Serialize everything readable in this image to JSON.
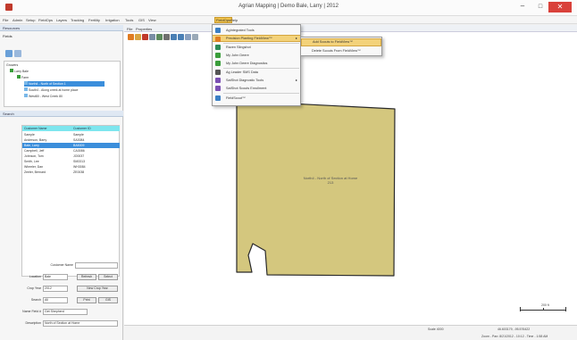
{
  "window": {
    "title": "Agrian Mapping | Demo Bale, Larry | 2012",
    "min_glyph": "–",
    "max_glyph": "□",
    "close_glyph": "✕"
  },
  "menubar": {
    "items": [
      "File",
      "Admin",
      "Setup",
      "FieldOps",
      "Layers",
      "Tracking",
      "Fertility",
      "Irrigation",
      "Tools",
      "GIS",
      "View",
      "FieldOps",
      "Help"
    ],
    "active_index": 11
  },
  "panels": {
    "resources_title": "Resources",
    "fields_label": "Fields",
    "growers_label": "Growers",
    "tree": {
      "root": "Growers",
      "grower": "Larry Bale",
      "farm": "Farm",
      "fields": [
        "North4 - North of Section 1",
        "South4 - Along creek at home place",
        "West80 - West Creek 80"
      ],
      "selected_index": 0
    },
    "search_title": "Search",
    "grid": {
      "headers": [
        "Customer Name",
        "Customer ID"
      ],
      "rows": [
        [
          "Sample",
          "Sample"
        ],
        [
          "Anderson, Barry",
          "SA3084"
        ],
        [
          "Bale, Larry",
          "BA5009"
        ],
        [
          "Campbell, Jeff",
          "CA3086"
        ],
        [
          "Johnson, Tom",
          "JO0037"
        ],
        [
          "Smith, Lee",
          "SM3313"
        ],
        [
          "Wheeler, Dan",
          "WH3084"
        ],
        [
          "Zeeler, Bernard",
          "ZE0038"
        ]
      ],
      "selected_index": 2
    },
    "form": {
      "customer_name_label": "Customer Name",
      "customer_name_value": "",
      "location_label": "Location",
      "location_value": "Bale",
      "refresh_btn": "Refresh",
      "select_btn": "Select",
      "crop_year_label": "Crop Year",
      "crop_year_value": "2012",
      "new_crop_year_btn": "New Crop Year",
      "search_label": "Search",
      "search_value": "All",
      "print_btn": "Print",
      "gis_btn": "GIS",
      "name_field_label": "Name Field #",
      "name_field_value": "Get Shepherd",
      "description_label": "Description",
      "description_value": "North of Section at Home"
    }
  },
  "map": {
    "tabs": [
      "File",
      "Properties"
    ],
    "field_label_line1": "North4 - North of Section at Home",
    "field_label_line2": "213",
    "field_fill": "#d4c77e",
    "field_stroke": "#2a2a2a",
    "scale_label": "200 ft"
  },
  "dropdown": {
    "items": [
      {
        "label": "AgIntegrated Tools",
        "icon_color": "#3b7fc4",
        "arrow": false
      },
      {
        "label": "Precision Planting FieldView™",
        "icon_color": "#e07b22",
        "arrow": true,
        "highlight": true
      },
      {
        "label": "Raven Slingshot",
        "icon_color": "#2e8b57",
        "arrow": false
      },
      {
        "label": "My John Deere",
        "icon_color": "#3a9d3a",
        "arrow": false
      },
      {
        "label": "My John Deere Diagnostics",
        "icon_color": "#3a9d3a",
        "arrow": false
      },
      {
        "label": "Ag Leader SMS Data",
        "icon_color": "#555555",
        "arrow": false
      },
      {
        "label": "SatShot Diagnostic Tools",
        "icon_color": "#7a4fb3",
        "arrow": true
      },
      {
        "label": "SatShot Scouts Enrollment",
        "icon_color": "#7a4fb3",
        "arrow": false
      },
      {
        "label": "FieldScout™",
        "icon_color": "#3b7fc4",
        "arrow": false
      }
    ],
    "submenu": [
      {
        "label": "Add Scouts to FieldView™",
        "highlight": true
      },
      {
        "label": "Delete Scouts From FieldView™",
        "highlight": false
      }
    ]
  },
  "status": {
    "scale": "Scale 4000",
    "coords": "46.603179, -95.576422",
    "left_hint": "",
    "right_hint": "Zoom - Pan: 8/21/2012 - 10:12 - Time - 1:58 AM"
  }
}
